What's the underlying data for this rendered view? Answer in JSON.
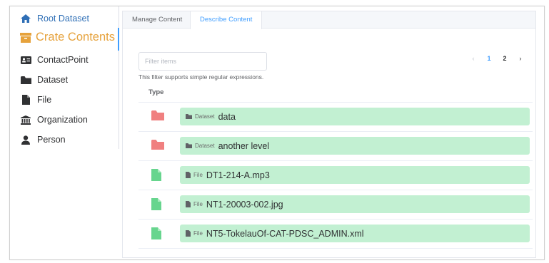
{
  "sidebar": {
    "root": {
      "label": "Root Dataset"
    },
    "crate": {
      "label": "Crate Contents"
    },
    "items": [
      {
        "label": "ContactPoint",
        "icon": "address-card-icon"
      },
      {
        "label": "Dataset",
        "icon": "folder-icon"
      },
      {
        "label": "File",
        "icon": "file-icon"
      },
      {
        "label": "Organization",
        "icon": "institution-icon"
      },
      {
        "label": "Person",
        "icon": "user-icon"
      }
    ]
  },
  "tabs": [
    {
      "label": "Manage Content"
    },
    {
      "label": "Describe Content"
    }
  ],
  "filter": {
    "placeholder": "Filter items",
    "hint": "This filter supports simple regular expressions."
  },
  "pagination": {
    "prev": "‹",
    "pages": [
      "1",
      "2"
    ],
    "next": "›"
  },
  "table": {
    "header": "Type",
    "rows": [
      {
        "kind": "Dataset",
        "name": "data"
      },
      {
        "kind": "Dataset",
        "name": "another level"
      },
      {
        "kind": "File",
        "name": "DT1-214-A.mp3"
      },
      {
        "kind": "File",
        "name": "NT1-20003-002.jpg"
      },
      {
        "kind": "File",
        "name": "NT5-TokelauOf-CAT-PDSC_ADMIN.xml"
      }
    ]
  },
  "colors": {
    "accent": "#409eff",
    "crate": "#e6a23c",
    "folder": "#f08080",
    "file": "#67d58e",
    "row_button": "#c2f0d2"
  }
}
